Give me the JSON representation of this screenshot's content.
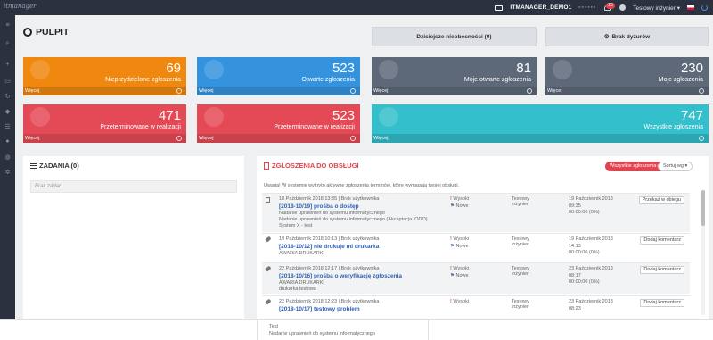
{
  "topbar": {
    "logo_text": "itmanager",
    "org_name": "ITMANAGER_DEMO1",
    "org_suffix_blurred": "▪▪▪▪▪▪",
    "notif_count": "28",
    "user_name": "Testowy inżynier",
    "user_caret": "▾"
  },
  "sidebar": {
    "icons": [
      "menu-icon",
      "search-icon",
      "plus-icon",
      "desktop-icon",
      "refresh-icon",
      "tag-icon",
      "list-icon",
      "users-icon",
      "globe-icon",
      "cogs-icon"
    ]
  },
  "page": {
    "title": "PULPIT"
  },
  "header_buttons": {
    "absences": "Dzisiejsze nieobecności (0)",
    "duties": "Brak dyżurów"
  },
  "tiles": [
    {
      "number": "69",
      "label": "Nieprzydzielone zgłoszenia",
      "footer": "Więcej",
      "color": "#f0870f"
    },
    {
      "number": "523",
      "label": "Otwarte zgłoszenia",
      "footer": "Więcej",
      "color": "#3593de"
    },
    {
      "number": "81",
      "label": "Moje otwarte zgłoszenia",
      "footer": "Więcej",
      "color": "#5d6878"
    },
    {
      "number": "230",
      "label": "Moje zgłoszenia",
      "footer": "Więcej",
      "color": "#5d6878"
    },
    {
      "number": "471",
      "label": "Przeterminowane w realizacji",
      "footer": "Więcej",
      "color": "#e44a56"
    },
    {
      "number": "523",
      "label": "Przeterminowane w realizacji",
      "footer": "Więcej",
      "color": "#e44a56"
    },
    {
      "number": "747",
      "label": "Wszystkie zgłoszenia",
      "footer": "Więcej",
      "color": "#33bfcb"
    }
  ],
  "tasks": {
    "title": "ZADANIA (0)",
    "empty": "Brak zadań"
  },
  "tickets": {
    "title": "ZGŁOSZENIA DO OBSŁUGI",
    "filter_btn": "Wszystkie zgłoszenia ▸",
    "sort_btn": "Sortuj wg ▾",
    "notice": "Uwaga! W systemie wykryto aktywne zgłoszenia terminów, które wymagają twojej obsługi.",
    "rows": [
      {
        "date": "18 Październik 2018 13:35 | Brak użytkownika",
        "title": "[2018-10/19] prośba o dostęp",
        "category": "Nadanie uprawnień do systemu informatycznego",
        "detail": "Nadanie uprawnień do systemu informatycznego (Akceptacja IODO)",
        "extra": "System X - test",
        "priority": "Wysoki",
        "status": "Nowe",
        "user": "Testowy inżynier",
        "deadline": "19 Październik 2018 09:35",
        "elapsed": "00:00:00 (0%)",
        "action": "Przekaż w obiegu"
      },
      {
        "date": "19 Październik 2018 10:13 | Brak użytkownika",
        "title": "[2018-10/12] nie drukuje mi drukarka",
        "category": "AWARIA DRUKARKI",
        "detail": "",
        "extra": "",
        "priority": "Wysoki",
        "status": "Nowe",
        "user": "Testowy inżynier",
        "deadline": "19 Październik 2018 14:13",
        "elapsed": "00:00:00 (0%)",
        "action": "Dodaj komentarz"
      },
      {
        "date": "22 Październik 2018 12:17 | Brak użytkownika",
        "title": "[2018-10/16] prośba o weryfikację zgłoszenia",
        "category": "AWARIA DRUKARKI",
        "detail": "drukarka testowa",
        "extra": "",
        "priority": "Wysoki",
        "status": "Nowe",
        "user": "Testowy inżynier",
        "deadline": "23 Październik 2018 08:17",
        "elapsed": "00:00:00 (0%)",
        "action": "Dodaj komentarz"
      },
      {
        "date": "22 Październik 2018 12:23 | Brak użytkownika",
        "title": "[2018-10/17] testowy problem",
        "category": "",
        "detail": "",
        "extra": "",
        "priority": "Wysoki",
        "status": "",
        "user": "Testowy inżynier",
        "deadline": "23 Październik 2018 08:23",
        "elapsed": "",
        "action": "Dodaj komentarz"
      }
    ]
  },
  "bottom": {
    "label": "Test",
    "category": "Nadanie uprawnień do systemu informatycznego"
  }
}
